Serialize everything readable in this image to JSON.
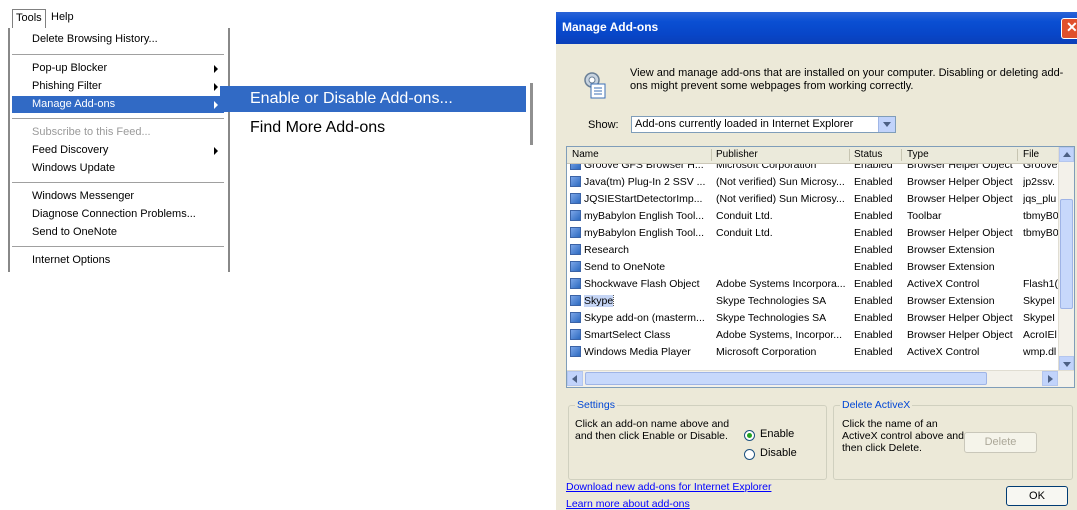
{
  "menubar": {
    "tools": "Tools",
    "help": "Help"
  },
  "tools_menu": {
    "items": [
      "Delete Browsing History...",
      "Pop-up Blocker",
      "Phishing Filter",
      "Manage Add-ons",
      "Subscribe to this Feed...",
      "Feed Discovery",
      "Windows Update",
      "Windows Messenger",
      "Diagnose Connection Problems...",
      "Send to OneNote",
      "Internet Options"
    ]
  },
  "submenu": {
    "items": [
      "Enable or Disable Add-ons...",
      "Find More Add-ons"
    ]
  },
  "dialog": {
    "title": "Manage Add-ons",
    "close_glyph": "✕",
    "intro": "View and manage add-ons that are installed on your computer. Disabling or deleting add-ons might prevent some webpages from working correctly.",
    "show_label": "Show:",
    "show_value": "Add-ons currently loaded in Internet Explorer",
    "columns": {
      "name": "Name",
      "publisher": "Publisher",
      "status": "Status",
      "type": "Type",
      "file": "File"
    },
    "rows": [
      {
        "name": "Groove GFS Browser H...",
        "publisher": "Microsoft Corporation",
        "status": "Enabled",
        "type": "Browser Helper Object",
        "file": "Groove"
      },
      {
        "name": "Java(tm) Plug-In 2 SSV ...",
        "publisher": "(Not verified) Sun Microsy...",
        "status": "Enabled",
        "type": "Browser Helper Object",
        "file": "jp2ssv."
      },
      {
        "name": "JQSIEStartDetectorImp...",
        "publisher": "(Not verified) Sun Microsy...",
        "status": "Enabled",
        "type": "Browser Helper Object",
        "file": "jqs_plu"
      },
      {
        "name": "myBabylon English Tool...",
        "publisher": "Conduit Ltd.",
        "status": "Enabled",
        "type": "Toolbar",
        "file": "tbmyB0"
      },
      {
        "name": "myBabylon English Tool...",
        "publisher": "Conduit Ltd.",
        "status": "Enabled",
        "type": "Browser Helper Object",
        "file": "tbmyB0"
      },
      {
        "name": "Research",
        "publisher": "",
        "status": "Enabled",
        "type": "Browser Extension",
        "file": ""
      },
      {
        "name": "Send to OneNote",
        "publisher": "",
        "status": "Enabled",
        "type": "Browser Extension",
        "file": ""
      },
      {
        "name": "Shockwave Flash Object",
        "publisher": "Adobe Systems Incorpora...",
        "status": "Enabled",
        "type": "ActiveX Control",
        "file": "Flash1("
      },
      {
        "name": "Skype",
        "publisher": "Skype Technologies SA",
        "status": "Enabled",
        "type": "Browser Extension",
        "file": "SkypeI"
      },
      {
        "name": "Skype add-on (masterm...",
        "publisher": "Skype Technologies SA",
        "status": "Enabled",
        "type": "Browser Helper Object",
        "file": "SkypeI"
      },
      {
        "name": "SmartSelect Class",
        "publisher": "Adobe Systems, Incorpor...",
        "status": "Enabled",
        "type": "Browser Helper Object",
        "file": "AcroIEl"
      },
      {
        "name": "Windows Media Player",
        "publisher": "Microsoft Corporation",
        "status": "Enabled",
        "type": "ActiveX Control",
        "file": "wmp.dl"
      }
    ],
    "settings": {
      "title": "Settings",
      "text": "Click an add-on name above and and then click Enable or Disable.",
      "enable": "Enable",
      "disable": "Disable"
    },
    "delete_activex": {
      "title": "Delete ActiveX",
      "text": "Click the name of an ActiveX control above and then click Delete.",
      "button": "Delete"
    },
    "link_download": "Download new add-ons for Internet Explorer",
    "link_learn": "Learn more about add-ons",
    "ok": "OK"
  },
  "colors": {
    "highlight": "#316ac5",
    "titlebar": "#0a4fd3",
    "dialog_bg": "#ece9d8",
    "link": "#0000ff"
  }
}
